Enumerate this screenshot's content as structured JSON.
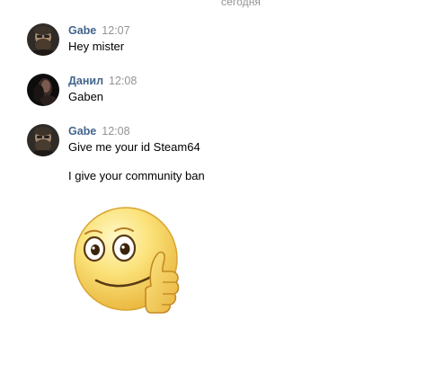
{
  "chat": {
    "date_separator": "сегодня",
    "messages": [
      {
        "author": "Gabe",
        "time": "12:07",
        "lines": [
          "Hey mister"
        ],
        "avatar": "gabe-avatar"
      },
      {
        "author": "Данил",
        "time": "12:08",
        "lines": [
          "Gaben"
        ],
        "avatar": "danil-avatar"
      },
      {
        "author": "Gabe",
        "time": "12:08",
        "lines": [
          "Give me your id Steam64",
          "I give your community ban"
        ],
        "avatar": "gabe-avatar",
        "sticker": "thumbs-up-smiley-sticker"
      }
    ]
  },
  "colors": {
    "author_link": "#42648b",
    "timestamp": "#939393",
    "sticker_face": "#f7d64a"
  }
}
